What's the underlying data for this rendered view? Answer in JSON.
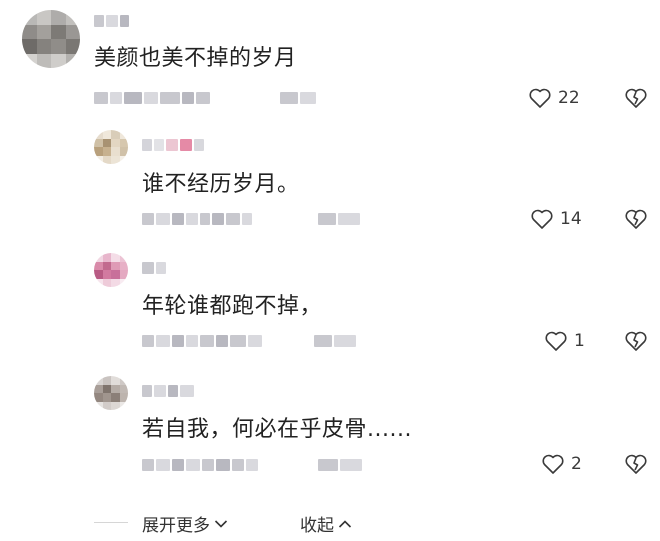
{
  "comments": [
    {
      "text": "美颜也美不掉的岁月",
      "likes": "22"
    },
    {
      "text": "谁不经历岁月。",
      "likes": "14"
    },
    {
      "text": "年轮谁都跑不掉，",
      "likes": "1"
    },
    {
      "text": "若自我，何必在乎皮骨......",
      "likes": "2"
    }
  ],
  "footer": {
    "expand_label": "展开更多",
    "collapse_label": "收起"
  },
  "icons": {
    "like": "heart-outline-icon",
    "dislike": "broken-heart-icon",
    "expand": "chevron-down-icon",
    "collapse": "chevron-up-icon"
  }
}
